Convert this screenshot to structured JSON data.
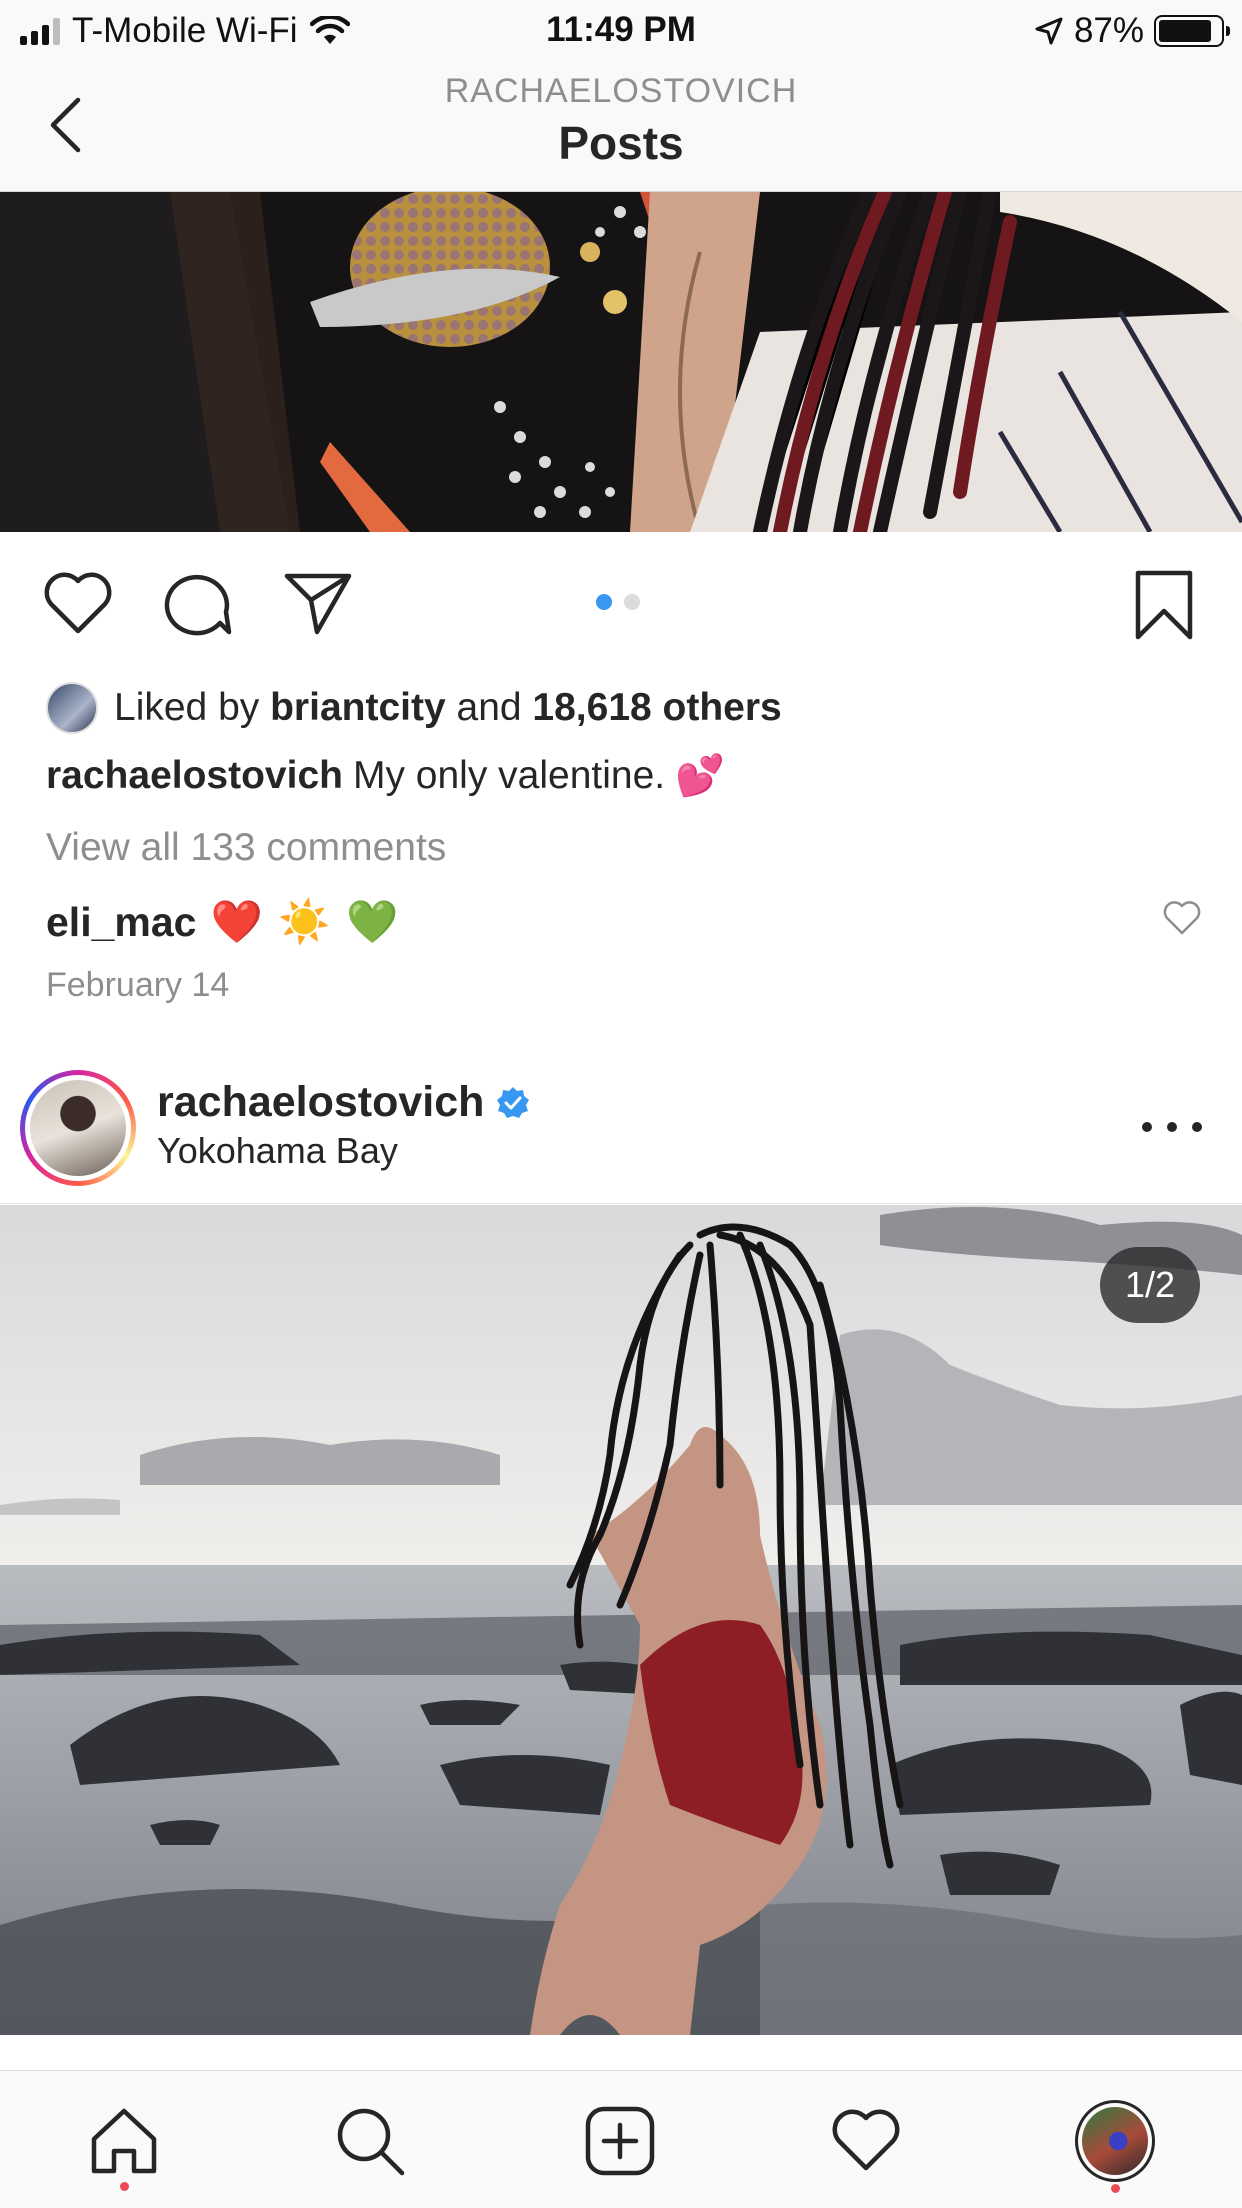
{
  "status_bar": {
    "carrier": "T-Mobile Wi-Fi",
    "time": "11:49 PM",
    "battery": "87%",
    "battery_level": 0.87
  },
  "header": {
    "username": "RACHAELOSTOVICH",
    "title": "Posts"
  },
  "post1": {
    "carousel": {
      "count": 2,
      "active": 0
    },
    "likes": {
      "prefix": "Liked by",
      "user": "briantcity",
      "joiner": "and",
      "others": "18,618 others"
    },
    "caption": {
      "username": "rachaelostovich",
      "text": "My only valentine.",
      "emoji": "💕"
    },
    "view_comments": "View all 133 comments",
    "comment": {
      "username": "eli_mac",
      "emojis": "❤️ ☀️ 💚"
    },
    "date": "February 14"
  },
  "post2": {
    "username": "rachaelostovich",
    "verified": true,
    "location": "Yokohama Bay",
    "counter": "1/2"
  },
  "tabs": [
    {
      "icon": "home-icon",
      "notification": true
    },
    {
      "icon": "search-icon",
      "notification": false
    },
    {
      "icon": "new-post-icon",
      "notification": false
    },
    {
      "icon": "activity-heart-icon",
      "notification": false
    },
    {
      "icon": "profile-avatar-icon",
      "notification": true
    }
  ],
  "colors": {
    "accent_blue": "#3897f0",
    "notification_red": "#ed4956",
    "secondary_text": "#8e8e8e"
  }
}
